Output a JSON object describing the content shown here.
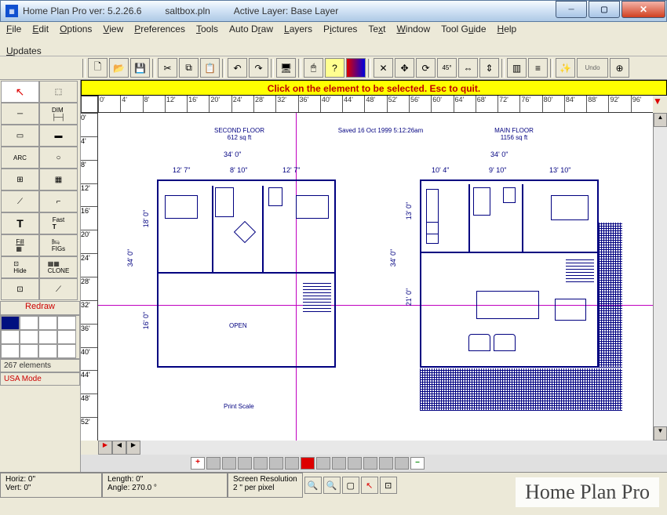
{
  "title": {
    "app": "Home Plan Pro ver: 5.2.26.6",
    "file": "saltbox.pln",
    "layer": "Active Layer: Base Layer"
  },
  "menu": [
    "File",
    "Edit",
    "Options",
    "View",
    "Preferences",
    "Tools",
    "Auto Draw",
    "Layers",
    "Pictures",
    "Text",
    "Window",
    "Tool Guide",
    "Help",
    "Updates"
  ],
  "hint": "Click on the element to be selected.  Esc to quit.",
  "ruler_h": [
    "0'",
    "4'",
    "8'",
    "12'",
    "16'",
    "20'",
    "24'",
    "28'",
    "32'",
    "36'",
    "40'",
    "44'",
    "48'",
    "52'",
    "56'",
    "60'",
    "64'",
    "68'",
    "72'",
    "76'",
    "80'",
    "84'",
    "88'",
    "92'",
    "96'"
  ],
  "ruler_v": [
    "0'",
    "4'",
    "8'",
    "12'",
    "16'",
    "20'",
    "24'",
    "28'",
    "32'",
    "36'",
    "40'",
    "44'",
    "48'",
    "52'"
  ],
  "tools_left": [
    "↖",
    "⬚",
    "—",
    "DIM",
    "▭",
    "▭",
    "ARC",
    "○",
    "▦",
    "⊞",
    "⟋",
    "⌐",
    "T",
    "Fast T",
    "Fill",
    "FIGs",
    "Hide",
    "CLONE",
    "⊡",
    "⟋"
  ],
  "redraw": "Redraw",
  "elements_count": "267 elements",
  "mode": "USA Mode",
  "plan": {
    "saved": "Saved 16 Oct 1999  5:12:26am",
    "left": {
      "title": "SECOND FLOOR",
      "area": "612 sq ft",
      "width": "34' 0\"",
      "dims": [
        "12' 7\"",
        "8' 10\"",
        "12' 7\""
      ],
      "height": "34' 0\"",
      "vdims": [
        "18' 0\"",
        "16' 0\""
      ],
      "open": "OPEN",
      "scale": "Print Scale"
    },
    "right": {
      "title": "MAIN FLOOR",
      "area": "1156 sq ft",
      "width": "34' 0\"",
      "dims": [
        "10' 4\"",
        "9' 10\"",
        "13' 10\""
      ],
      "height": "34' 0\"",
      "vdims": [
        "13' 0\"",
        "21' 0\""
      ]
    }
  },
  "status": {
    "horiz": "Horiz: 0\"",
    "vert": "Vert: 0\"",
    "length": "Length:  0\"",
    "angle": "Angle: 270.0 °",
    "res": "Screen Resolution",
    "scale": "2 \" per pixel"
  },
  "watermark": "Home Plan Pro",
  "undo": "Undo"
}
